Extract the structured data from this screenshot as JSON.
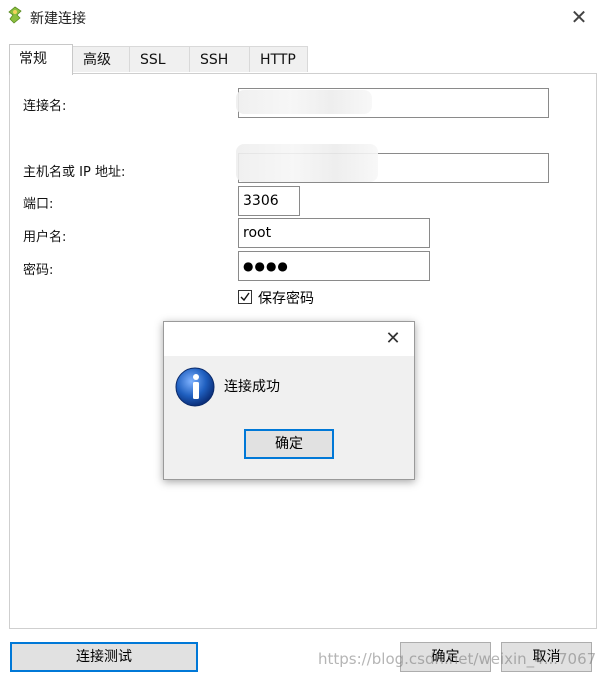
{
  "window": {
    "title": "新建连接",
    "close_symbol": "✕",
    "icon": "connection-icon"
  },
  "tabs": [
    {
      "label": "常规",
      "active": true
    },
    {
      "label": "高级",
      "active": false
    },
    {
      "label": "SSL",
      "active": false
    },
    {
      "label": "SSH",
      "active": false
    },
    {
      "label": "HTTP",
      "active": false
    }
  ],
  "form": {
    "connection_name_label": "连接名:",
    "host_label": "主机名或 IP 地址:",
    "port_label": "端口:",
    "port_value": "3306",
    "user_label": "用户名:",
    "user_value": "root",
    "password_label": "密码:",
    "password_value": "●●●●",
    "save_password_label": "保存密码",
    "save_password_checked": true
  },
  "buttons": {
    "test_connection": "连接测试",
    "ok": "确定",
    "cancel": "取消"
  },
  "dialog": {
    "message": "连接成功",
    "ok_label": "确定",
    "close_symbol": "✕",
    "icon": "info-icon"
  },
  "watermark": "https://blog.csdn.net/weixin_4...7067",
  "colors": {
    "focus_border": "#0078d7",
    "info_icon_blue": "#1f5fbf"
  }
}
